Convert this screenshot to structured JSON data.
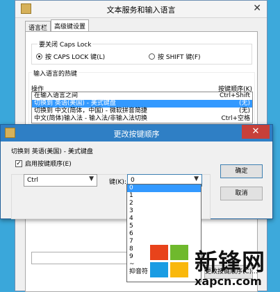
{
  "main_window": {
    "title": "文本服务和输入语言",
    "close_glyph": "✕",
    "tabs": [
      {
        "label": "语言栏",
        "active": false
      },
      {
        "label": "高级键设置",
        "active": true
      }
    ],
    "caps_lock": {
      "title": "要关闭 Caps Lock",
      "options": [
        {
          "label": "按 CAPS LOCK 键(L)",
          "selected": true
        },
        {
          "label": "按 SHIFT 键(F)",
          "selected": false
        }
      ]
    },
    "hotkeys": {
      "title": "输入语言的热键",
      "col_action": "操作",
      "col_sequence": "按键顺序(K)",
      "rows": [
        {
          "action": "在输入语言之间",
          "keys": "Ctrl+Shift",
          "selected": false
        },
        {
          "action": "切换到 英语(美国) - 美式键盘",
          "keys": "(无)",
          "selected": true
        },
        {
          "action": "切换到 中文(简体，中国) - 微软拼音简捷",
          "keys": "(无)",
          "selected": false
        },
        {
          "action": "中文(简体)输入法 - 输入法/非输入法切换",
          "keys": "Ctrl+空格",
          "selected": false
        }
      ]
    },
    "change_sequence_button": "更改按键顺序(C)..."
  },
  "dialog": {
    "title": "更改按键顺序",
    "close_glyph": "✕",
    "subtitle": "切换到 英语(美国) - 美式键盘",
    "enable_label": "启用按键顺序(E)",
    "enable_checked": true,
    "modifier_value": "Ctrl",
    "key_label": "键(K):",
    "key_value": "0",
    "ok_label": "确定",
    "cancel_label": "取消",
    "key_options": [
      "0",
      "1",
      "2",
      "3",
      "4",
      "5",
      "6",
      "7",
      "8",
      "9",
      "~",
      "抑音符"
    ],
    "selected_option_index": 0
  },
  "watermark": {
    "name": "新锋网",
    "url": "xapcn.com"
  },
  "colors": {
    "selection": "#3399ff",
    "dialog_titlebar": "#2f7fc5",
    "close_button": "#c7403a",
    "desktop": "#3ea9dc"
  }
}
